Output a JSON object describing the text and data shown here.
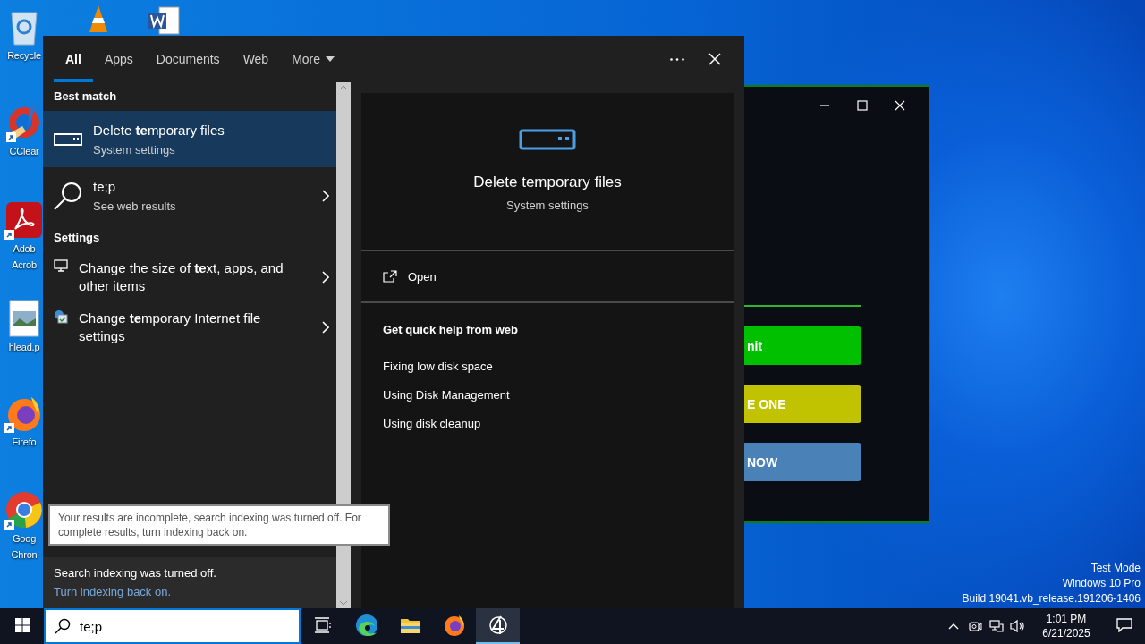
{
  "desktop": {
    "icons": [
      {
        "kind": "recycle",
        "lines": [
          "Recycle"
        ],
        "shortcut": false
      },
      {
        "kind": "ccleaner",
        "lines": [
          "CClear"
        ],
        "shortcut": true
      },
      {
        "kind": "acrobat",
        "lines": [
          "Adob",
          "Acrob"
        ],
        "shortcut": true
      },
      {
        "kind": "image",
        "lines": [
          "hlead.p"
        ],
        "shortcut": false
      },
      {
        "kind": "firefox",
        "lines": [
          "Firefo"
        ],
        "shortcut": true
      },
      {
        "kind": "chrome",
        "lines": [
          "Goog",
          "Chron"
        ],
        "shortcut": true
      }
    ],
    "system_notice": [
      "Test Mode",
      "Windows 10 Pro",
      "Build 19041.vb_release.191206-1406"
    ]
  },
  "search": {
    "tabs": [
      {
        "label": "All",
        "selected": true
      },
      {
        "label": "Apps",
        "selected": false
      },
      {
        "label": "Documents",
        "selected": false
      },
      {
        "label": "Web",
        "selected": false
      },
      {
        "label": "More",
        "selected": false,
        "dropdown": true
      }
    ],
    "sections": [
      {
        "header": "Best match",
        "items": [
          {
            "kind": "app",
            "title": "Delete **te**mporary files",
            "subtitle": "System settings",
            "selected": true,
            "arrow": false
          },
          {
            "kind": "web",
            "title": "te;p",
            "subtitle": "See web results",
            "selected": false,
            "arrow": true
          }
        ]
      },
      {
        "header": "Settings",
        "items": [
          {
            "kind": "display",
            "title": "Change the size of **te**xt, apps, and other items",
            "selected": false,
            "arrow": true
          },
          {
            "kind": "internet",
            "title": "Change **te**mporary Internet file settings",
            "selected": false,
            "arrow": true
          }
        ]
      }
    ],
    "tooltip": "Your results are incomplete, search indexing was turned off. For complete results, turn indexing back on.",
    "notice": {
      "text": "Search indexing was turned off.",
      "link": "Turn indexing back on."
    },
    "preview": {
      "title": "Delete temporary files",
      "subtitle": "System settings",
      "actions": [
        {
          "label": "Open"
        }
      ],
      "help_title": "Get quick help from web",
      "help_links": [
        "Fixing low disk space",
        "Using Disk Management",
        "Using disk cleanup"
      ]
    }
  },
  "background_window": {
    "buttons": [
      {
        "label": "nit",
        "color": "#00c000"
      },
      {
        "label": "E ONE",
        "color": "#c2c300"
      },
      {
        "label": "NOW",
        "color": "#4a82b8"
      }
    ]
  },
  "taskbar": {
    "search_value": "te;p",
    "apps": [
      {
        "kind": "taskview",
        "active": false
      },
      {
        "kind": "edge",
        "active": false
      },
      {
        "kind": "explorer",
        "active": false
      },
      {
        "kind": "firefox",
        "active": false
      },
      {
        "kind": "custom",
        "active": true
      }
    ],
    "clock": {
      "time": "1:01 PM",
      "date": "6/21/2025"
    }
  }
}
